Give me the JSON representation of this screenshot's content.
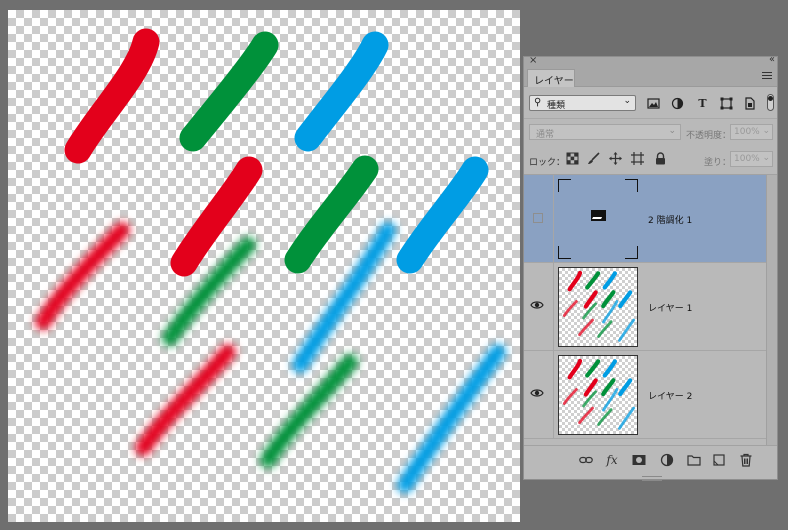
{
  "canvas": {
    "strokes": [
      {
        "color": "#e3001b",
        "blur": false
      },
      {
        "color": "#00913a",
        "blur": false
      },
      {
        "color": "#009de4",
        "blur": false
      },
      {
        "color": "#e3001b",
        "blur": false
      },
      {
        "color": "#00913a",
        "blur": false
      },
      {
        "color": "#009de4",
        "blur": false
      },
      {
        "color": "#e3001b",
        "blur": true
      },
      {
        "color": "#00913a",
        "blur": true
      },
      {
        "color": "#009de4",
        "blur": true
      },
      {
        "color": "#e3001b",
        "blur": true
      },
      {
        "color": "#00913a",
        "blur": true
      },
      {
        "color": "#009de4",
        "blur": true
      }
    ]
  },
  "panel": {
    "tab_label": "レイヤー",
    "close_glyph": "×",
    "collapse_glyph": "‹‹",
    "filter": {
      "kind_label": "種類",
      "icons": [
        "image-filter-icon",
        "adjustment-filter-icon",
        "type-filter-icon",
        "shape-filter-icon",
        "smart-object-filter-icon"
      ]
    },
    "blend_mode": "通常",
    "opacity_label": "不透明度：",
    "opacity_value": "100%",
    "lock_label": "ロック：",
    "fill_label": "塗り：",
    "fill_value": "100%",
    "layers": [
      {
        "name": "2 階調化 1",
        "type": "adjustment",
        "visible": false,
        "selected": true
      },
      {
        "name": "レイヤー 1",
        "type": "pixel",
        "visible": true,
        "selected": false
      },
      {
        "name": "レイヤー 2",
        "type": "pixel",
        "visible": true,
        "selected": false
      }
    ],
    "bottom_icons": [
      "link-icon",
      "fx-icon",
      "mask-icon",
      "adjustment-icon",
      "folder-icon",
      "new-layer-icon",
      "trash-icon"
    ]
  },
  "icon_glyphs": {
    "magnifier": "⚲",
    "dropdown": "⌄",
    "eye": "◉",
    "type_T": "T",
    "fx": "fx"
  }
}
